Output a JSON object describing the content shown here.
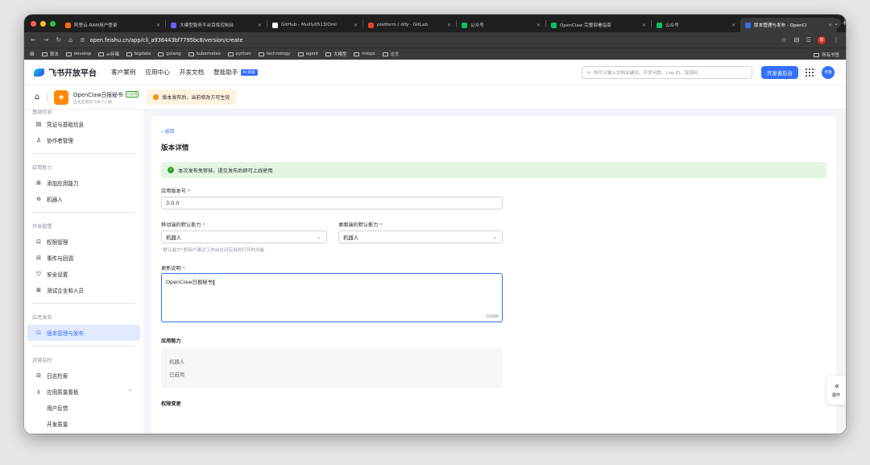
{
  "browser": {
    "tabs": [
      {
        "title": "阿里云-RAM用户登录",
        "color": "#ff6a00",
        "active": false
      },
      {
        "title": "大模型服务平台百炼控制台",
        "color": "#6a5cff",
        "active": false
      },
      {
        "title": "GitHub - Mullly0513/Omi",
        "color": "#ffffff",
        "active": false
      },
      {
        "title": "platform / dify · GitLab",
        "color": "#e24329",
        "active": false
      },
      {
        "title": "公众号",
        "color": "#07c160",
        "active": false
      },
      {
        "title": "OpenClaw 完整部署指南",
        "color": "#07c160",
        "active": false
      },
      {
        "title": "公众号",
        "color": "#07c160",
        "active": false
      },
      {
        "title": "版本管理与发布 - OpenCl",
        "color": "#3370ff",
        "active": true
      }
    ],
    "url": "open.feishu.cn/app/cli_a936443bf7795bc8/version/create",
    "bookmarks": [
      "算法",
      "develop",
      "ai存储",
      "bigdata",
      "golang",
      "kubernetes",
      "python",
      "technology",
      "agent",
      "大模型",
      "mlops",
      "论文"
    ],
    "all_bookmarks": "所有书签",
    "profile_letter": "暂"
  },
  "topnav": {
    "brand": "飞书开放平台",
    "items": [
      "客户案例",
      "应用中心",
      "开发文档",
      "智能助手"
    ],
    "ai_badge": "AI 开发",
    "search_placeholder": "你可以输入文档关键词、开发问题、Log ID、错误码",
    "dev_button": "开发者后台",
    "avatar_text": "老歌"
  },
  "appbar": {
    "app_name": "OpenClaw日报秘书",
    "status_tag": "已启用",
    "app_sub": "正式应用仅飞书个人版",
    "notice": "版本发布后，当前修改方可生效"
  },
  "sidebar": {
    "top_label": "基础信息",
    "groups": [
      {
        "title": "",
        "items": [
          {
            "label": "凭证与基础信息",
            "icon": "credential-icon",
            "glyph": "▤"
          },
          {
            "label": "协作者管理",
            "icon": "collaborator-icon",
            "glyph": "♙"
          }
        ]
      },
      {
        "title": "应用能力",
        "items": [
          {
            "label": "添加应用能力",
            "icon": "add-capability-icon",
            "glyph": "⊞"
          },
          {
            "label": "机器人",
            "icon": "robot-icon",
            "glyph": "⊖"
          }
        ]
      },
      {
        "title": "开发配置",
        "items": [
          {
            "label": "权限管理",
            "icon": "permission-icon",
            "glyph": "⊡"
          },
          {
            "label": "事件与回调",
            "icon": "event-icon",
            "glyph": "⊟"
          },
          {
            "label": "安全设置",
            "icon": "security-icon",
            "glyph": "⛉"
          },
          {
            "label": "测试企业和人员",
            "icon": "test-icon",
            "glyph": "⊠"
          }
        ]
      },
      {
        "title": "应用发布",
        "items": [
          {
            "label": "版本管理与发布",
            "icon": "release-icon",
            "glyph": "⊡",
            "active": true
          }
        ]
      },
      {
        "title": "运营监控",
        "items": [
          {
            "label": "日志检索",
            "icon": "log-icon",
            "glyph": "⊟"
          },
          {
            "label": "应用质量看板",
            "icon": "quality-icon",
            "glyph": "⫫",
            "chevron": "⌃"
          },
          {
            "label": "用户反馈",
            "sub": true
          },
          {
            "label": "开发质量",
            "sub": true
          }
        ]
      }
    ]
  },
  "main": {
    "back": "返回",
    "title": "版本详情",
    "success_msg": "本次发布免审核，提交发布后即可上线使用",
    "version_label": "应用版本号",
    "version_value": "3.0.0",
    "mobile_label": "移动端的默认能力",
    "mobile_value": "机器人",
    "desktop_label": "桌面端的默认能力",
    "desktop_value": "机器人",
    "default_hint": "\"默认能力\"即用户通过工作台访问应用时打开的功能",
    "notes_label": "更新说明",
    "notes_value": "OpenClaw日报秘书",
    "notes_count": "12/500",
    "capability_label": "应用能力",
    "capability_name": "机器人",
    "capability_status": "已启用",
    "permission_label": "权限变更",
    "expand_label": "展开"
  }
}
